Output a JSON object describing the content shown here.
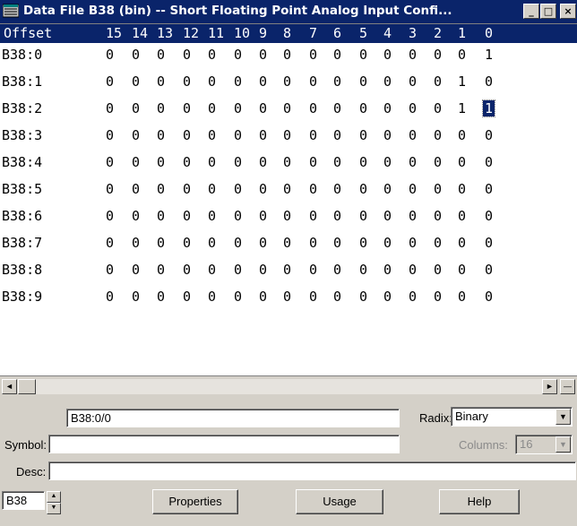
{
  "window": {
    "title": "Data File B38 (bin) -- Short Floating Point Analog Input Confi...",
    "minimize_glyph": "_",
    "maximize_glyph": "□",
    "close_glyph": "×"
  },
  "grid": {
    "offset_header": "Offset",
    "bit_headers": [
      "15",
      "14",
      "13",
      "12",
      "11",
      "10",
      "9",
      "8",
      "7",
      "6",
      "5",
      "4",
      "3",
      "2",
      "1",
      "0"
    ],
    "rows": [
      {
        "label": "B38:0",
        "bits": [
          "0",
          "0",
          "0",
          "0",
          "0",
          "0",
          "0",
          "0",
          "0",
          "0",
          "0",
          "0",
          "0",
          "0",
          "0",
          "1"
        ]
      },
      {
        "label": "B38:1",
        "bits": [
          "0",
          "0",
          "0",
          "0",
          "0",
          "0",
          "0",
          "0",
          "0",
          "0",
          "0",
          "0",
          "0",
          "0",
          "1",
          "0"
        ]
      },
      {
        "label": "B38:2",
        "bits": [
          "0",
          "0",
          "0",
          "0",
          "0",
          "0",
          "0",
          "0",
          "0",
          "0",
          "0",
          "0",
          "0",
          "0",
          "1",
          "1"
        ]
      },
      {
        "label": "B38:3",
        "bits": [
          "0",
          "0",
          "0",
          "0",
          "0",
          "0",
          "0",
          "0",
          "0",
          "0",
          "0",
          "0",
          "0",
          "0",
          "0",
          "0"
        ]
      },
      {
        "label": "B38:4",
        "bits": [
          "0",
          "0",
          "0",
          "0",
          "0",
          "0",
          "0",
          "0",
          "0",
          "0",
          "0",
          "0",
          "0",
          "0",
          "0",
          "0"
        ]
      },
      {
        "label": "B38:5",
        "bits": [
          "0",
          "0",
          "0",
          "0",
          "0",
          "0",
          "0",
          "0",
          "0",
          "0",
          "0",
          "0",
          "0",
          "0",
          "0",
          "0"
        ]
      },
      {
        "label": "B38:6",
        "bits": [
          "0",
          "0",
          "0",
          "0",
          "0",
          "0",
          "0",
          "0",
          "0",
          "0",
          "0",
          "0",
          "0",
          "0",
          "0",
          "0"
        ]
      },
      {
        "label": "B38:7",
        "bits": [
          "0",
          "0",
          "0",
          "0",
          "0",
          "0",
          "0",
          "0",
          "0",
          "0",
          "0",
          "0",
          "0",
          "0",
          "0",
          "0"
        ]
      },
      {
        "label": "B38:8",
        "bits": [
          "0",
          "0",
          "0",
          "0",
          "0",
          "0",
          "0",
          "0",
          "0",
          "0",
          "0",
          "0",
          "0",
          "0",
          "0",
          "0"
        ]
      },
      {
        "label": "B38:9",
        "bits": [
          "0",
          "0",
          "0",
          "0",
          "0",
          "0",
          "0",
          "0",
          "0",
          "0",
          "0",
          "0",
          "0",
          "0",
          "0",
          "0"
        ]
      }
    ],
    "selected_cell": {
      "row": 2,
      "bit": "0"
    }
  },
  "scrollbar": {
    "left_glyph": "◄",
    "right_glyph": "►",
    "collapse_glyph": "—"
  },
  "address_field": {
    "value": "B38:0/0"
  },
  "radix": {
    "label": "Radix:",
    "value": "Binary"
  },
  "symbol": {
    "label": "Symbol:",
    "value": ""
  },
  "columns": {
    "label": "Columns:",
    "value": "16"
  },
  "desc": {
    "label": "Desc:",
    "value": ""
  },
  "file_field": {
    "value": "B38"
  },
  "buttons": {
    "properties": "Properties",
    "usage": "Usage",
    "help": "Help"
  },
  "colors": {
    "selection": "#0a246a",
    "face": "#d4d0c8"
  }
}
